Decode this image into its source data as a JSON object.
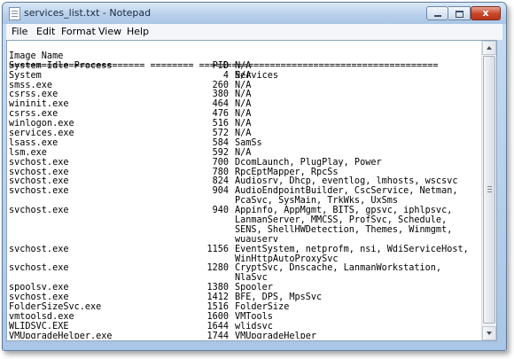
{
  "window": {
    "title": "services_list.txt - Notepad",
    "close_glyph": "x"
  },
  "menu": {
    "items": [
      "File",
      "Edit",
      "Format",
      "View",
      "Help"
    ]
  },
  "document": {
    "header": {
      "name": "Image Name",
      "pid": "PID",
      "services": "Services"
    },
    "separator": "========================= ======== ============================================",
    "rows": [
      {
        "name": "System Idle Process",
        "pid": "0",
        "services": "N/A"
      },
      {
        "name": "System",
        "pid": "4",
        "services": "N/A"
      },
      {
        "name": "smss.exe",
        "pid": "260",
        "services": "N/A"
      },
      {
        "name": "csrss.exe",
        "pid": "380",
        "services": "N/A"
      },
      {
        "name": "wininit.exe",
        "pid": "464",
        "services": "N/A"
      },
      {
        "name": "csrss.exe",
        "pid": "476",
        "services": "N/A"
      },
      {
        "name": "winlogon.exe",
        "pid": "516",
        "services": "N/A"
      },
      {
        "name": "services.exe",
        "pid": "572",
        "services": "N/A"
      },
      {
        "name": "lsass.exe",
        "pid": "584",
        "services": "SamSs"
      },
      {
        "name": "lsm.exe",
        "pid": "592",
        "services": "N/A"
      },
      {
        "name": "svchost.exe",
        "pid": "700",
        "services": "DcomLaunch, PlugPlay, Power"
      },
      {
        "name": "svchost.exe",
        "pid": "780",
        "services": "RpcEptMapper, RpcSs"
      },
      {
        "name": "svchost.exe",
        "pid": "824",
        "services": "Audiosrv, Dhcp, eventlog, lmhosts, wscsvc"
      },
      {
        "name": "svchost.exe",
        "pid": "904",
        "services": "AudioEndpointBuilder, CscService, Netman,"
      },
      {
        "name": "",
        "pid": "",
        "services": "PcaSvc, SysMain, TrkWks, UxSms"
      },
      {
        "name": "svchost.exe",
        "pid": "940",
        "services": "Appinfo, AppMgmt, BITS, gpsvc, iphlpsvc,"
      },
      {
        "name": "",
        "pid": "",
        "services": "LanmanServer, MMCSS, ProfSvc, Schedule,"
      },
      {
        "name": "",
        "pid": "",
        "services": "SENS, ShellHWDetection, Themes, Winmgmt,"
      },
      {
        "name": "",
        "pid": "",
        "services": "wuauserv"
      },
      {
        "name": "svchost.exe",
        "pid": "1156",
        "services": "EventSystem, netprofm, nsi, WdiServiceHost,"
      },
      {
        "name": "",
        "pid": "",
        "services": "WinHttpAutoProxySvc"
      },
      {
        "name": "svchost.exe",
        "pid": "1280",
        "services": "CryptSvc, Dnscache, LanmanWorkstation,"
      },
      {
        "name": "",
        "pid": "",
        "services": "NlaSvc"
      },
      {
        "name": "spoolsv.exe",
        "pid": "1380",
        "services": "Spooler"
      },
      {
        "name": "svchost.exe",
        "pid": "1412",
        "services": "BFE, DPS, MpsSvc"
      },
      {
        "name": "FolderSizeSvc.exe",
        "pid": "1516",
        "services": "FolderSize"
      },
      {
        "name": "vmtoolsd.exe",
        "pid": "1600",
        "services": "VMTools"
      },
      {
        "name": "WLIDSVC.EXE",
        "pid": "1644",
        "services": "wlidsvc"
      },
      {
        "name": "VMUpgradeHelper.exe",
        "pid": "1744",
        "services": "VMUpgradeHelper"
      }
    ]
  },
  "icons": {
    "app": "notepad-icon",
    "minimize": "minimize-icon",
    "maximize": "maximize-icon",
    "close": "close-icon",
    "scroll_up": "arrow-up-icon",
    "scroll_down": "arrow-down-icon"
  },
  "colors": {
    "titlebar": "#b9d1ec",
    "close_button": "#c94528",
    "menubar": "#f4f6fa",
    "editor_bg": "#ffffff"
  }
}
